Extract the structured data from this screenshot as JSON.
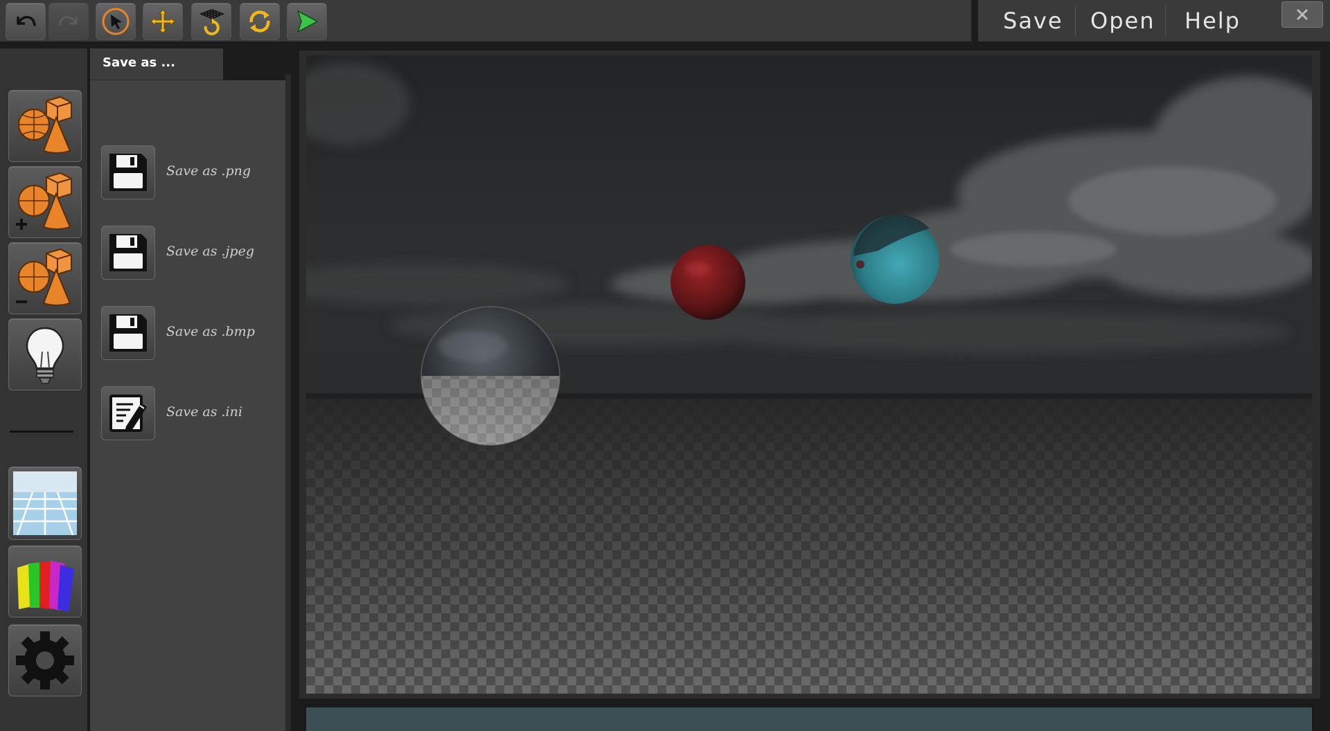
{
  "toolbar": {
    "buttons": [
      {
        "name": "undo-icon"
      },
      {
        "name": "redo-icon"
      },
      {
        "name": "select-icon"
      },
      {
        "name": "move-icon"
      },
      {
        "name": "grid-rotate-icon"
      },
      {
        "name": "refresh-icon"
      },
      {
        "name": "play-render-icon"
      }
    ]
  },
  "menu": {
    "save_label": "Save",
    "open_label": "Open",
    "help_label": "Help"
  },
  "sidebar": {
    "items": [
      {
        "name": "objects-icon"
      },
      {
        "name": "add-object-icon"
      },
      {
        "name": "remove-object-icon"
      },
      {
        "name": "light-bulb-icon"
      },
      {
        "name": "floor-grid-icon"
      },
      {
        "name": "color-swatches-icon"
      },
      {
        "name": "settings-gear-icon"
      }
    ]
  },
  "save_panel": {
    "tab_label": "Save as ...",
    "items": [
      {
        "label": "Save as .png",
        "icon": "floppy-disk-icon"
      },
      {
        "label": "Save as .jpeg",
        "icon": "floppy-disk-icon"
      },
      {
        "label": "Save as .bmp",
        "icon": "floppy-disk-icon"
      },
      {
        "label": "Save as .ini",
        "icon": "edit-document-icon"
      }
    ]
  },
  "colors": {
    "accent_orange": "#e8842a",
    "play_green": "#3fc24a",
    "bottom_bar": "#3b4f55"
  }
}
